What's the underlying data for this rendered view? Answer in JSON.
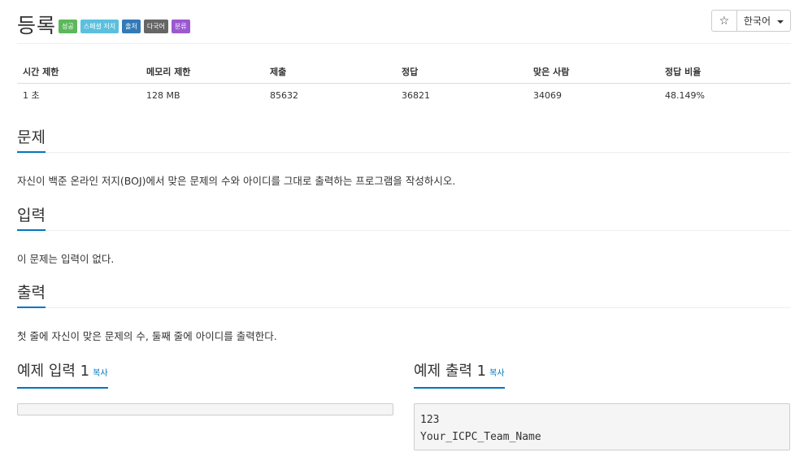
{
  "title": "등록",
  "badges": [
    {
      "label": "성공",
      "color": "#5cb85c"
    },
    {
      "label": "스페셜 저지",
      "color": "#5bc0de"
    },
    {
      "label": "출처",
      "color": "#337ab7"
    },
    {
      "label": "다국어",
      "color": "#666666"
    },
    {
      "label": "분류",
      "color": "#9b59d0"
    }
  ],
  "toolbar": {
    "star": "☆",
    "language": "한국어"
  },
  "stats": {
    "headers": [
      "시간 제한",
      "메모리 제한",
      "제출",
      "정답",
      "맞은 사람",
      "정답 비율"
    ],
    "values": [
      "1 초",
      "128 MB",
      "85632",
      "36821",
      "34069",
      "48.149%"
    ]
  },
  "problem": {
    "title": "문제",
    "body": "자신이 백준 온라인 저지(BOJ)에서 맞은 문제의 수와 아이디를 그대로 출력하는 프로그램을 작성하시오."
  },
  "input": {
    "title": "입력",
    "body": "이 문제는 입력이 없다."
  },
  "output": {
    "title": "출력",
    "body": "첫 줄에 자신이 맞은 문제의 수, 둘째 줄에 아이디를 출력한다."
  },
  "sample_input": {
    "title": "예제 입력 1",
    "copy": "복사",
    "content": ""
  },
  "sample_output": {
    "title": "예제 출력 1",
    "copy": "복사",
    "lines": [
      "123",
      "Your_ICPC_Team_Name"
    ]
  }
}
